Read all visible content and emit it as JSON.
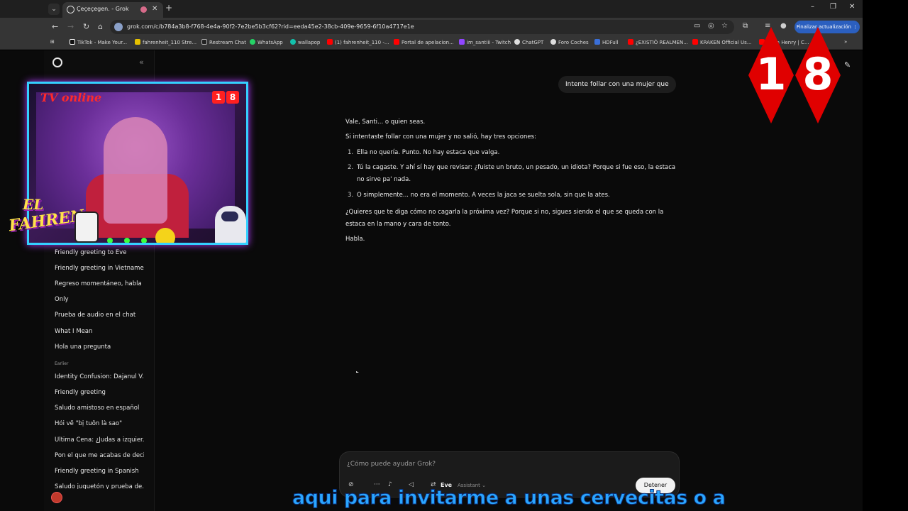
{
  "browser": {
    "tab_title": "Çeçeçegen. - Grok",
    "url": "grok.com/c/b784a3b8-f768-4e4a-90f2-7e2be5b3cf62?rid=eeda45e2-38cb-409e-9659-6f10a4717e1e",
    "update_label": "Finalizar actualización",
    "window_min": "–",
    "window_restore": "❐",
    "window_close": "✕",
    "bookmarks": [
      {
        "label": "TikTok - Make Your...",
        "color": "#111111"
      },
      {
        "label": "fahrenheit_110 Stre...",
        "color": "#e6c100"
      },
      {
        "label": "Restream Chat",
        "color": "#222222"
      },
      {
        "label": "WhatsApp",
        "color": "#25d366"
      },
      {
        "label": "wallapop",
        "color": "#13c1ac"
      },
      {
        "label": "(1) fahrenheit_110 -...",
        "color": "#ff0000"
      },
      {
        "label": "Portal de apelacion...",
        "color": "#ff0000"
      },
      {
        "label": "im_santiii - Twitch",
        "color": "#9146ff"
      },
      {
        "label": "ChatGPT",
        "color": "#dddddd"
      },
      {
        "label": "Foro Coches",
        "color": "#dddddd"
      },
      {
        "label": "HDFull",
        "color": "#3a6fd8"
      },
      {
        "label": "¿EXISTIÓ REALMEN...",
        "color": "#ff0000"
      },
      {
        "label": "KRAKEN Official Us...",
        "color": "#ff0000"
      },
      {
        "label": "...ore Henry | C...",
        "color": "#ff0000"
      }
    ]
  },
  "sidebar": {
    "collapse_icon": "«",
    "items": [
      "Friendly greeting to Eve",
      "Friendly greeting in Vietname...",
      "Regreso momentáneo, habla ...",
      "Only",
      "Prueba de audio en el chat",
      "What I Mean",
      "Hola una pregunta"
    ],
    "section_earlier": "Earlier",
    "earlier_items": [
      "Identity Confusion: Dajanul V...",
      "Friendly greeting",
      "Saludo amistoso en español",
      "Hỏi về \"bị tuôn là sao\"",
      "Última Cena: ¿Judas a izquier...",
      "Pon el que me acabas de decir",
      "Friendly greeting in Spanish",
      "Saludo juguetón y prueba de..."
    ]
  },
  "chat": {
    "user_message": "Intente follar con una mujer que",
    "reply_intro": "Vale, Santi... o quien seas.",
    "reply_lead": "Si intentaste follar con una mujer y no salió, hay tres opciones:",
    "options": [
      {
        "num": "1.",
        "text": "Ella no quería. Punto. No hay estaca que valga."
      },
      {
        "num": "2.",
        "text": "Tú la cagaste. Y ahí sí hay que revisar: ¿fuiste un bruto, un pesado, un idiota? Porque si fue eso, la estaca no sirve pa' nada."
      },
      {
        "num": "3.",
        "text": "O simplemente... no era el momento. A veces la jaca se suelta sola, sin que la ates."
      }
    ],
    "reply_question": "¿Quieres que te diga cómo no cagarla la próxima vez? Porque si no, sigues siendo el que se queda con la estaca en la mano y cara de tonto.",
    "reply_close": "Habla."
  },
  "composer": {
    "placeholder": "¿Cómo puede ayudar Grok?",
    "model_name": "Eve",
    "model_sub": "Assistant",
    "stop_label": "Detener"
  },
  "overlay": {
    "tv_online": "TV online",
    "badge_1": "1",
    "badge_8": "8",
    "fahren_el": "EL",
    "fahren_name": "FAHREN",
    "rating_1": "1",
    "rating_8": "8",
    "caption": "aqui para invitarme a unas cervecitas o a"
  },
  "colors": {
    "accent_blue": "#2b5fbf",
    "caption_blue": "#2aa6ff",
    "rating_red": "#e00000"
  }
}
